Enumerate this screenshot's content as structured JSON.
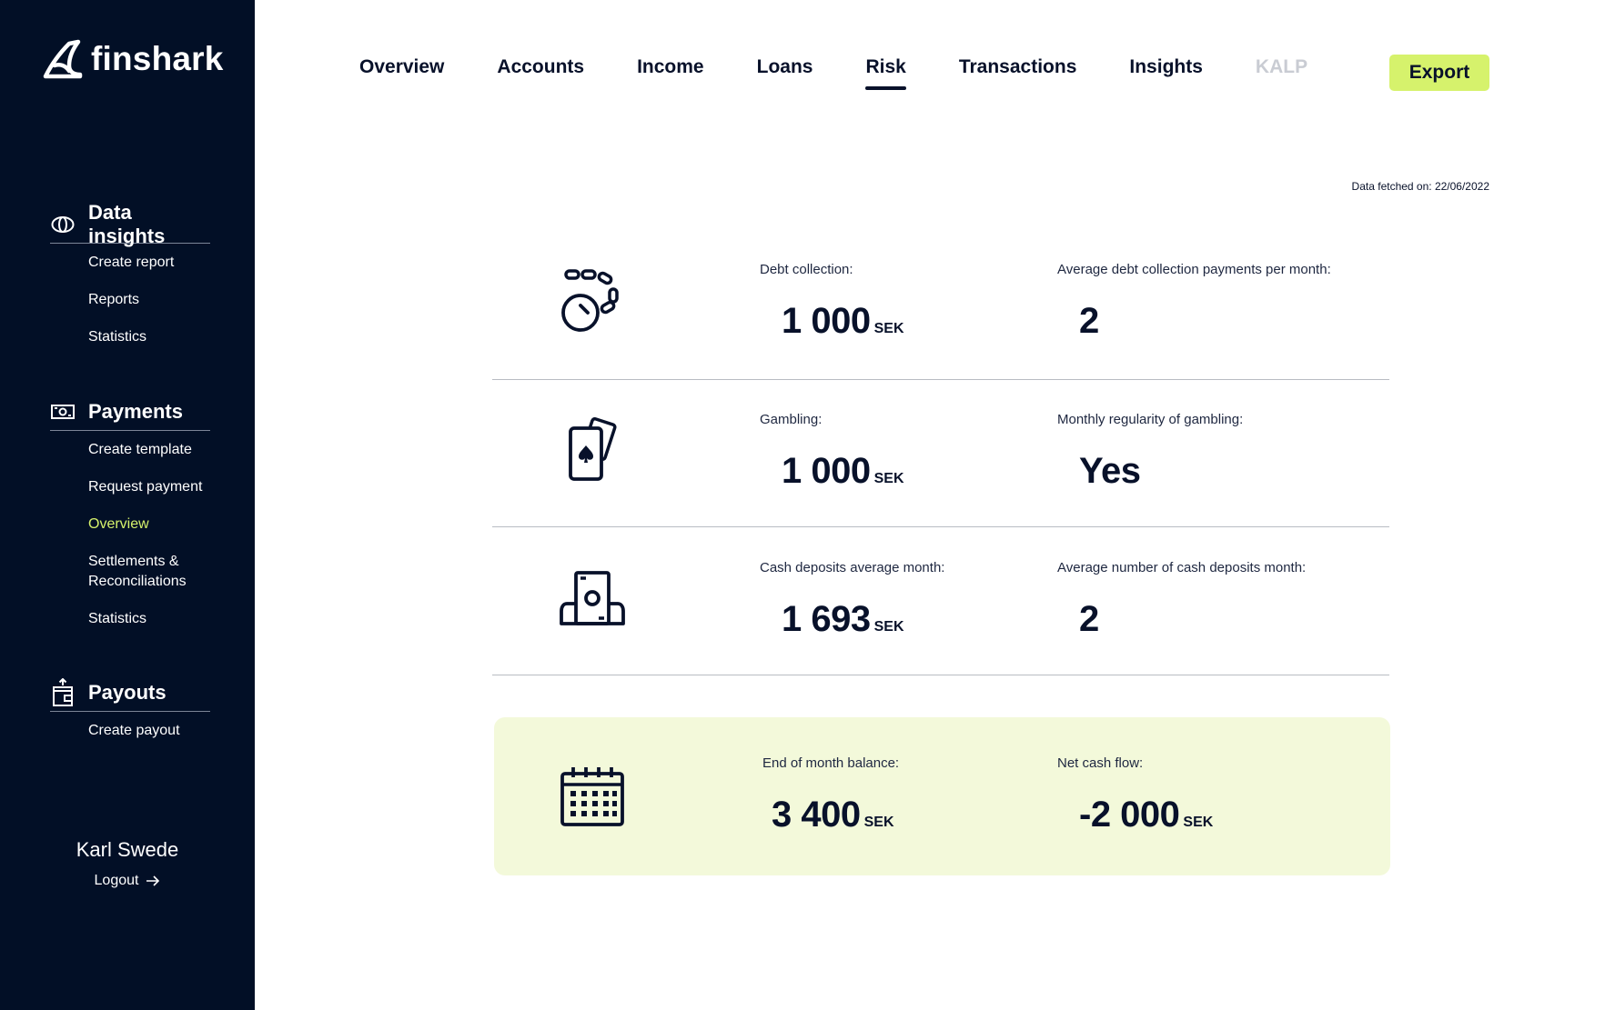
{
  "app": {
    "brand": "finshark"
  },
  "sidebar": {
    "sections": [
      {
        "title": "Data insights",
        "icon": "eye-icon",
        "items": [
          "Create report",
          "Reports",
          "Statistics"
        ]
      },
      {
        "title": "Payments",
        "icon": "banknote-icon",
        "items": [
          "Create template",
          "Request payment",
          "Overview",
          "Settlements & Reconciliations",
          "Statistics"
        ],
        "active_item": "Overview"
      },
      {
        "title": "Payouts",
        "icon": "wallet-upload-icon",
        "items": [
          "Create payout"
        ]
      }
    ],
    "user": {
      "name": "Karl Swede",
      "logout_label": "Logout"
    }
  },
  "topnav": {
    "tabs": [
      "Overview",
      "Accounts",
      "Income",
      "Loans",
      "Risk",
      "Transactions",
      "Insights",
      "KALP"
    ],
    "active_tab": "Risk",
    "disabled_tab": "KALP",
    "export_label": "Export"
  },
  "main": {
    "fetched_text": "Data fetched on: 22/06/2022",
    "rows": [
      {
        "icon": "ball-and-chain-icon",
        "label1": "Debt collection:",
        "value1": "1 000",
        "unit1": "SEK",
        "label2": "Average debt collection payments per month:",
        "value2": "2"
      },
      {
        "icon": "playing-cards-icon",
        "label1": "Gambling:",
        "value1": "1 000",
        "unit1": "SEK",
        "label2": "Monthly regularity of gambling:",
        "value2": "Yes"
      },
      {
        "icon": "cash-deposit-icon",
        "label1": "Cash deposits average month:",
        "value1": "1 693",
        "unit1": "SEK",
        "label2": "Average number of cash deposits month:",
        "value2": "2"
      }
    ],
    "summary": {
      "icon": "calendar-icon",
      "label1": "End of month balance:",
      "value1": "3 400",
      "unit1": "SEK",
      "label2": "Net cash flow:",
      "value2": "-2 000",
      "unit2": "SEK"
    }
  },
  "colors": {
    "sidebar_bg": "#020f26",
    "accent": "#d6f26c",
    "highlight_bg": "#f3f9da",
    "text": "#08112a"
  }
}
